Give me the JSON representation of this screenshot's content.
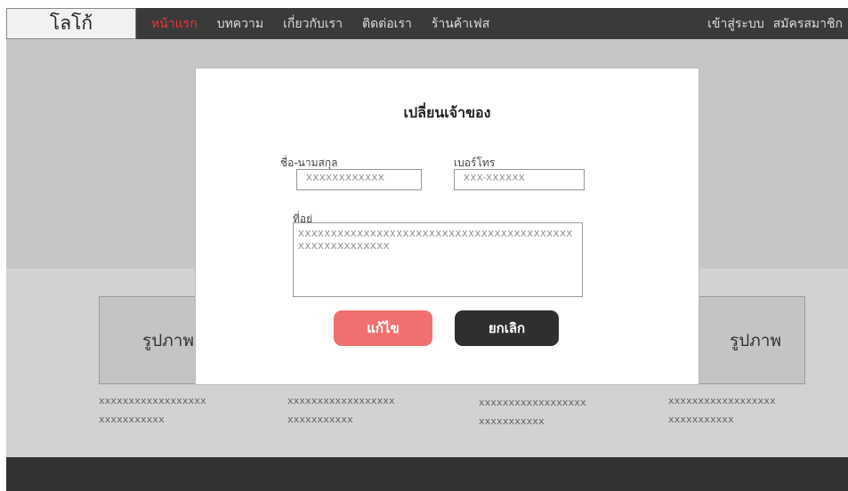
{
  "header": {
    "logo": "โลโก้",
    "nav": [
      {
        "label": "หน้าแรก",
        "active": true
      },
      {
        "label": "บทความ"
      },
      {
        "label": "เกี่ยวกับเรา"
      },
      {
        "label": "ติดต่อเรา"
      },
      {
        "label": "ร้านค้าเฟส"
      }
    ],
    "auth": {
      "login": "เข้าสู่ระบบ",
      "register": "สมัครสมาชิก"
    }
  },
  "cards": [
    {
      "image_label": "รูปภาพ",
      "line1": "xxxxxxxxxxxxxxxxxx",
      "line2": "xxxxxxxxxxx"
    },
    {
      "image_label": "",
      "line1": "xxxxxxxxxxxxxxxxxx",
      "line2": "xxxxxxxxxxx"
    },
    {
      "image_label": "",
      "line1": "xxxxxxxxxxxxxxxxxx",
      "line2": "xxxxxxxxxxx"
    },
    {
      "image_label": "รูปภาพ",
      "line1": "xxxxxxxxxxxxxxxxxx",
      "line2": "xxxxxxxxxxx"
    }
  ],
  "modal": {
    "title": "เปลี่ยนเจ้าของ",
    "name_label": "ชื่อ-นามสกุล",
    "name_value": "XXXXXXXXXXXX",
    "phone_label": "เบอร์โทร",
    "phone_value": "XXX-XXXXXX",
    "address_label": "ที่อยู่",
    "address_value": "XXXXXXXXXXXXXXXXXXXXXXXXXXXXXXXXXXXXXXXXXXXXXXXXXXXXXXXX",
    "save_label": "แก้ไข",
    "cancel_label": "ยกเลิก"
  },
  "colors": {
    "accent": "#e53935",
    "save_button": "#f07070",
    "cancel_button": "#2f2f2f",
    "header_bg": "#3a3a3a"
  }
}
